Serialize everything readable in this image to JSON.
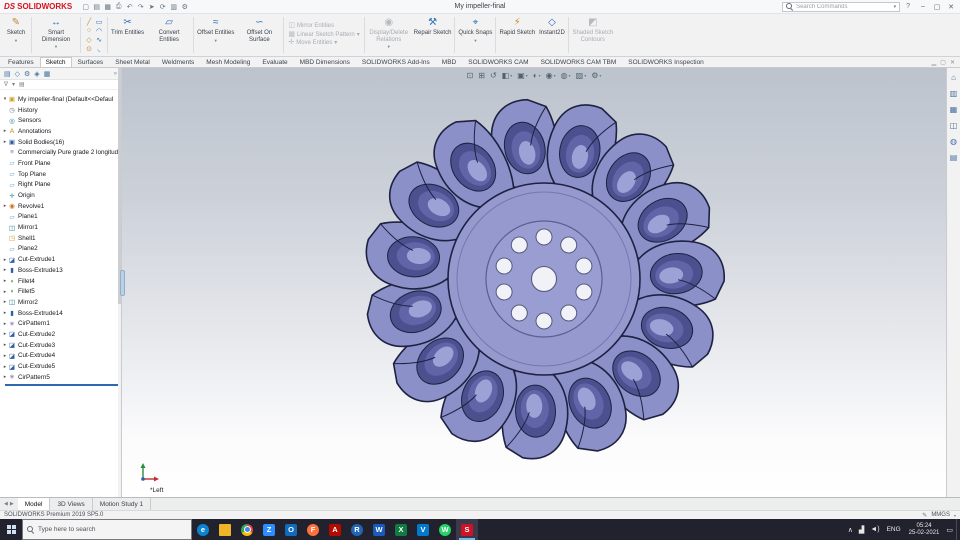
{
  "colors": {
    "accent_red": "#d8121d",
    "impeller_outline": "#1e2142",
    "impeller_fill": "#8b90c8",
    "impeller_cup_dark": "#4c508e",
    "impeller_cup_mid": "#6165a8",
    "impeller_cup_light": "#9ca1d6",
    "disk_fill": "#9599cd",
    "disk_inner_fill": "#999dd1",
    "ring_line": "#5a5d90",
    "hole_fill": "#f1f2f7",
    "hole_stroke": "#565a80",
    "taskbar_bg": "#22222e"
  },
  "title_bar": {
    "logo_prefix": "DS",
    "app_name": "SOLIDWORKS",
    "document_title": "My impeller-final",
    "search_placeholder": "Search Commands",
    "quick_access": [
      {
        "name": "new-file-icon",
        "glyph": "▢"
      },
      {
        "name": "open-file-icon",
        "glyph": "▤"
      },
      {
        "name": "save-icon",
        "glyph": "▦"
      },
      {
        "name": "print-icon",
        "glyph": "⎙"
      },
      {
        "name": "undo-icon",
        "glyph": "↶"
      },
      {
        "name": "redo-icon",
        "glyph": "↷"
      },
      {
        "name": "select-icon",
        "glyph": "➤"
      },
      {
        "name": "rebuild-icon",
        "glyph": "⟳"
      },
      {
        "name": "file-properties-icon",
        "glyph": "▥"
      },
      {
        "name": "options-icon",
        "glyph": "⚙"
      }
    ]
  },
  "ribbon": {
    "buttons": [
      {
        "label": "Sketch",
        "enabled": true
      },
      {
        "label": "Smart Dimension",
        "enabled": true
      },
      {
        "label": "Trim Entities",
        "enabled": true
      },
      {
        "label": "Convert Entities",
        "enabled": true
      },
      {
        "label": "Offset Entities",
        "enabled": true
      },
      {
        "label": "Offset On Surface",
        "enabled": true
      },
      {
        "label": "Mirror Entities",
        "enabled": false
      },
      {
        "label": "Linear Sketch Pattern",
        "enabled": false
      },
      {
        "label": "Move Entities",
        "enabled": false
      },
      {
        "label": "Display/Delete Relations",
        "enabled": false
      },
      {
        "label": "Repair Sketch",
        "enabled": true
      },
      {
        "label": "Quick Snaps",
        "enabled": true
      },
      {
        "label": "Rapid Sketch",
        "enabled": true
      },
      {
        "label": "Instant2D",
        "enabled": true
      },
      {
        "label": "Shaded Sketch Contours",
        "enabled": false
      }
    ],
    "entity_tools": [
      {
        "name": "line-tool-icon",
        "glyph": "╱"
      },
      {
        "name": "corner-rectangle-tool-icon",
        "glyph": "▭"
      },
      {
        "name": "circle-tool-icon",
        "glyph": "○"
      },
      {
        "name": "centerpoint-arc-tool-icon",
        "glyph": "◠"
      },
      {
        "name": "polygon-tool-icon",
        "glyph": "◇"
      },
      {
        "name": "spline-tool-icon",
        "glyph": "∿"
      },
      {
        "name": "ellipse-tool-icon",
        "glyph": "⊙"
      },
      {
        "name": "sketch-fillet-tool-icon",
        "glyph": "◟"
      }
    ]
  },
  "command_tabs": {
    "items": [
      "Features",
      "Sketch",
      "Surfaces",
      "Sheet Metal",
      "Weldments",
      "Mesh Modeling",
      "Evaluate",
      "MBD Dimensions",
      "SOLIDWORKS Add-Ins",
      "MBD",
      "SOLIDWORKS CAM",
      "SOLIDWORKS CAM TBM",
      "SOLIDWORKS Inspection"
    ],
    "active": "Sketch"
  },
  "left_panel": {
    "tabs": [
      {
        "name": "featuremanager-tab-icon",
        "glyph": "▤"
      },
      {
        "name": "propertymanager-tab-icon",
        "glyph": "◇"
      },
      {
        "name": "configurationmanager-tab-icon",
        "glyph": "⚙"
      },
      {
        "name": "dimxpertmanager-tab-icon",
        "glyph": "◈"
      },
      {
        "name": "displaymanager-tab-icon",
        "glyph": "▦"
      }
    ],
    "filter_icons": [
      {
        "name": "filter-icon",
        "glyph": "∇"
      },
      {
        "name": "filter-dropdown-icon",
        "glyph": "▾"
      },
      {
        "name": "tree-display-icon",
        "glyph": "▤"
      }
    ]
  },
  "feature_tree": {
    "items": [
      {
        "label": "My impeller-final (Default<<Defaul",
        "icon": "part-icon",
        "glyph": "▣",
        "color": "#c9a227",
        "expanded": true
      },
      {
        "label": "History",
        "icon": "history-icon",
        "glyph": "◷",
        "color": "#6b7280"
      },
      {
        "label": "Sensors",
        "icon": "sensors-icon",
        "glyph": "◎",
        "color": "#1f7a99"
      },
      {
        "label": "Annotations",
        "icon": "annotations-icon",
        "glyph": "A",
        "color": "#b8860b",
        "expandable": true
      },
      {
        "label": "Solid Bodies(16)",
        "icon": "solid-bodies-icon",
        "glyph": "▣",
        "color": "#2e5fa3",
        "expandable": true
      },
      {
        "label": "Commercially Pure grade 2 longitud",
        "icon": "material-icon",
        "glyph": "≡",
        "color": "#7a8088"
      },
      {
        "label": "Front Plane",
        "icon": "plane-icon",
        "glyph": "▱",
        "color": "#5b9bd5"
      },
      {
        "label": "Top Plane",
        "icon": "plane-icon",
        "glyph": "▱",
        "color": "#5b9bd5"
      },
      {
        "label": "Right Plane",
        "icon": "plane-icon",
        "glyph": "▱",
        "color": "#5b9bd5"
      },
      {
        "label": "Origin",
        "icon": "origin-icon",
        "glyph": "✛",
        "color": "#16808c"
      },
      {
        "label": "Revolve1",
        "icon": "revolve-icon",
        "glyph": "◉",
        "color": "#c77429",
        "expandable": true
      },
      {
        "label": "Plane1",
        "icon": "plane-icon",
        "glyph": "▱",
        "color": "#5b9bd5"
      },
      {
        "label": "Mirror1",
        "icon": "mirror-icon",
        "glyph": "◫",
        "color": "#16808c"
      },
      {
        "label": "Shell1",
        "icon": "shell-icon",
        "glyph": "◳",
        "color": "#c9a227"
      },
      {
        "label": "Plane2",
        "icon": "plane-icon",
        "glyph": "▱",
        "color": "#5b9bd5"
      },
      {
        "label": "Cut-Extrude1",
        "icon": "cut-extrude-icon",
        "glyph": "◪",
        "color": "#2e5fa3",
        "expandable": true
      },
      {
        "label": "Boss-Extrude13",
        "icon": "boss-extrude-icon",
        "glyph": "▮",
        "color": "#2e5fa3",
        "expandable": true
      },
      {
        "label": "Fillet4",
        "icon": "fillet-icon",
        "glyph": "◖",
        "color": "#3f8f3f",
        "expandable": true
      },
      {
        "label": "Fillet5",
        "icon": "fillet-icon",
        "glyph": "◖",
        "color": "#3f8f3f",
        "expandable": true
      },
      {
        "label": "Mirror2",
        "icon": "mirror-icon",
        "glyph": "◫",
        "color": "#16808c",
        "expandable": true
      },
      {
        "label": "Boss-Extrude14",
        "icon": "boss-extrude-icon",
        "glyph": "▮",
        "color": "#2e5fa3",
        "expandable": true
      },
      {
        "label": "CirPattern1",
        "icon": "circular-pattern-icon",
        "glyph": "✳",
        "color": "#6b4fa3",
        "expandable": true
      },
      {
        "label": "Cut-Extrude2",
        "icon": "cut-extrude-icon",
        "glyph": "◪",
        "color": "#2e5fa3",
        "expandable": true
      },
      {
        "label": "Cut-Extrude3",
        "icon": "cut-extrude-icon",
        "glyph": "◪",
        "color": "#2e5fa3",
        "expandable": true
      },
      {
        "label": "Cut-Extrude4",
        "icon": "cut-extrude-icon",
        "glyph": "◪",
        "color": "#2e5fa3",
        "expandable": true
      },
      {
        "label": "Cut-Extrude5",
        "icon": "cut-extrude-icon",
        "glyph": "◪",
        "color": "#2e5fa3",
        "expandable": true
      },
      {
        "label": "CirPattern5",
        "icon": "circular-pattern-icon",
        "glyph": "✳",
        "color": "#6b4fa3",
        "expandable": true
      }
    ]
  },
  "viewport": {
    "orientation_label": "*Left",
    "hud_icons": [
      {
        "name": "zoom-to-fit-icon",
        "glyph": "⊡"
      },
      {
        "name": "zoom-to-area-icon",
        "glyph": "⊞"
      },
      {
        "name": "previous-view-icon",
        "glyph": "↺"
      },
      {
        "name": "section-view-icon",
        "glyph": "◧",
        "dropdown": true
      },
      {
        "name": "view-orientation-icon",
        "glyph": "▣",
        "dropdown": true
      },
      {
        "name": "display-style-icon",
        "glyph": "◐",
        "dropdown": true
      },
      {
        "name": "hide-show-items-icon",
        "glyph": "◉",
        "dropdown": true
      },
      {
        "name": "edit-appearance-icon",
        "glyph": "◍",
        "dropdown": true
      },
      {
        "name": "apply-scene-icon",
        "glyph": "▨",
        "dropdown": true
      },
      {
        "name": "view-settings-icon",
        "glyph": "⚙",
        "dropdown": true
      }
    ],
    "impeller": {
      "bucket_count": 15,
      "bolt_hole_count": 10
    }
  },
  "task_pane": {
    "icons": [
      {
        "name": "solidworks-resources-icon",
        "glyph": "⌂"
      },
      {
        "name": "design-library-icon",
        "glyph": "▥"
      },
      {
        "name": "file-explorer-pane-icon",
        "glyph": "▦"
      },
      {
        "name": "view-palette-icon",
        "glyph": "◫"
      },
      {
        "name": "appearances-scenes-icon",
        "glyph": "◍"
      },
      {
        "name": "custom-properties-icon",
        "glyph": "▤"
      }
    ]
  },
  "bottom_bar": {
    "tabs": [
      "Model",
      "3D Views",
      "Motion Study 1"
    ],
    "active_tab": "Model",
    "status_text": "SOLIDWORKS Premium 2019 SP5.0",
    "units": "MMGS"
  },
  "taskbar": {
    "search_placeholder": "Type here to search",
    "apps": [
      {
        "name": "edge-icon",
        "glyph": "e",
        "color": "#0a84d0",
        "shape": "circle"
      },
      {
        "name": "file-explorer-icon",
        "glyph": "",
        "color": "#f0b429",
        "shape": "folder"
      },
      {
        "name": "chrome-icon",
        "glyph": "",
        "color": "",
        "shape": "chrome"
      },
      {
        "name": "zoom-icon",
        "glyph": "Z",
        "color": "#2d8cff",
        "shape": "square"
      },
      {
        "name": "outlook-icon",
        "glyph": "O",
        "color": "#0f6cbd",
        "shape": "square"
      },
      {
        "name": "firefox-icon",
        "glyph": "F",
        "color": "#ff7139",
        "shape": "circle"
      },
      {
        "name": "acrobat-icon",
        "glyph": "A",
        "color": "#b30b00",
        "shape": "square"
      },
      {
        "name": "rstudio-icon",
        "glyph": "R",
        "color": "#2165b6",
        "shape": "circle"
      },
      {
        "name": "word-icon",
        "glyph": "W",
        "color": "#185abd",
        "shape": "square"
      },
      {
        "name": "excel-icon",
        "glyph": "X",
        "color": "#107c41",
        "shape": "square"
      },
      {
        "name": "vscode-icon",
        "glyph": "V",
        "color": "#007acc",
        "shape": "square"
      },
      {
        "name": "whatsapp-icon",
        "glyph": "W",
        "color": "#25d366",
        "shape": "circle"
      },
      {
        "name": "solidworks-icon",
        "glyph": "S",
        "color": "#cf1322",
        "shape": "square",
        "active": true
      }
    ],
    "tray": {
      "icons": [
        {
          "name": "hidden-icons-chevron",
          "glyph": "∧"
        },
        {
          "name": "network-icon",
          "glyph": "▟"
        },
        {
          "name": "volume-icon",
          "glyph": "◄)"
        }
      ],
      "lang": "ENG",
      "time": "05:24",
      "date": "25-02-2021"
    }
  }
}
